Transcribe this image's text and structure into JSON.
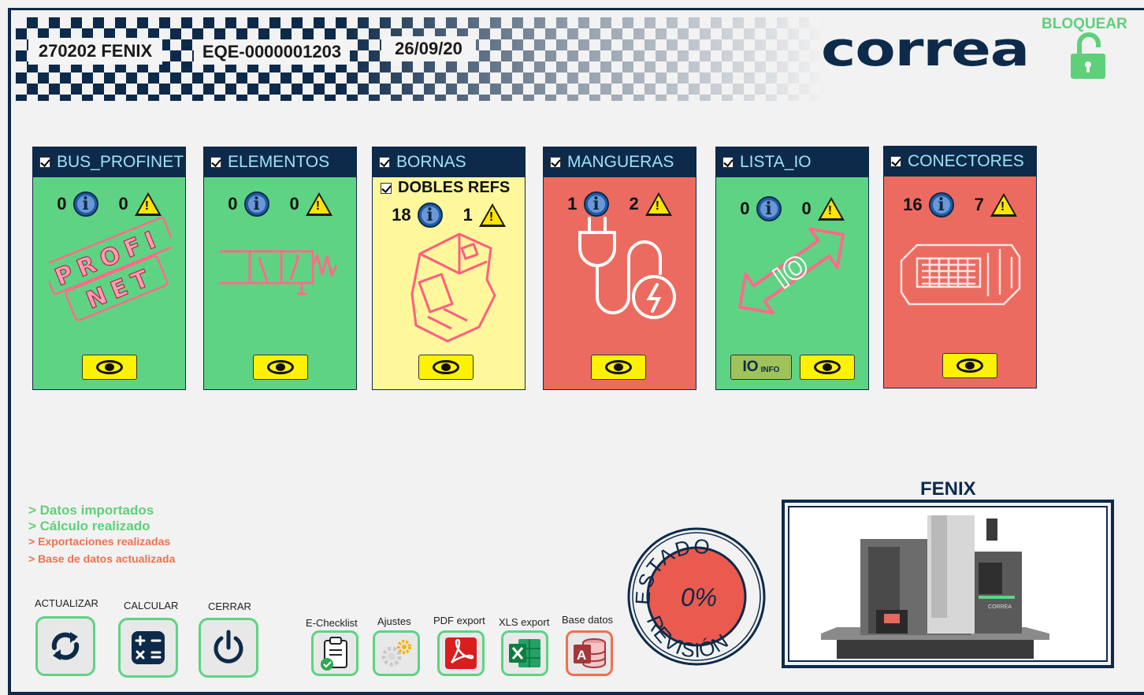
{
  "header": {
    "order": "270202 FENIX",
    "equipment": "EQE-0000001203",
    "date": "26/09/20",
    "logo": "correa",
    "lock_label": "BLOQUEAR"
  },
  "cards": [
    {
      "title": "BUS_PROFINET",
      "info": "0",
      "warn": "0",
      "color": "green"
    },
    {
      "title": "ELEMENTOS",
      "info": "0",
      "warn": "0",
      "color": "green"
    },
    {
      "title": "BORNAS",
      "sub": "DOBLES REFS",
      "info": "18",
      "warn": "1",
      "color": "yellow"
    },
    {
      "title": "MANGUERAS",
      "info": "1",
      "warn": "2",
      "color": "red"
    },
    {
      "title": "LISTA_IO",
      "info": "0",
      "warn": "0",
      "color": "green",
      "io_big": "IO",
      "io_small": "INFO"
    },
    {
      "title": "CONECTORES",
      "info": "16",
      "warn": "7",
      "color": "red"
    }
  ],
  "profinet_art": [
    "PROFI",
    "NET"
  ],
  "status_lines": [
    "> Datos importados",
    "> Cálculo realizado",
    "> Exportaciones realizadas",
    "> Base de datos actualizada"
  ],
  "main_buttons": {
    "update": "ACTUALIZAR",
    "calculate": "CALCULAR",
    "close": "CERRAR"
  },
  "tool_buttons": {
    "checklist": "E-Checklist",
    "settings": "Ajustes",
    "pdf": "PDF export",
    "xls": "XLS export",
    "db": "Base datos"
  },
  "stamp": {
    "top": "ESTADO",
    "bottom": "REVISIÓN",
    "percent": "0%"
  },
  "machine": {
    "title": "FENIX",
    "brand": "CORREA"
  },
  "colors": {
    "navy": "#0d2a4a",
    "green": "#5ed383",
    "red": "#ec6b60",
    "yellow": "#fff79c",
    "button_yellow": "#fff200"
  }
}
